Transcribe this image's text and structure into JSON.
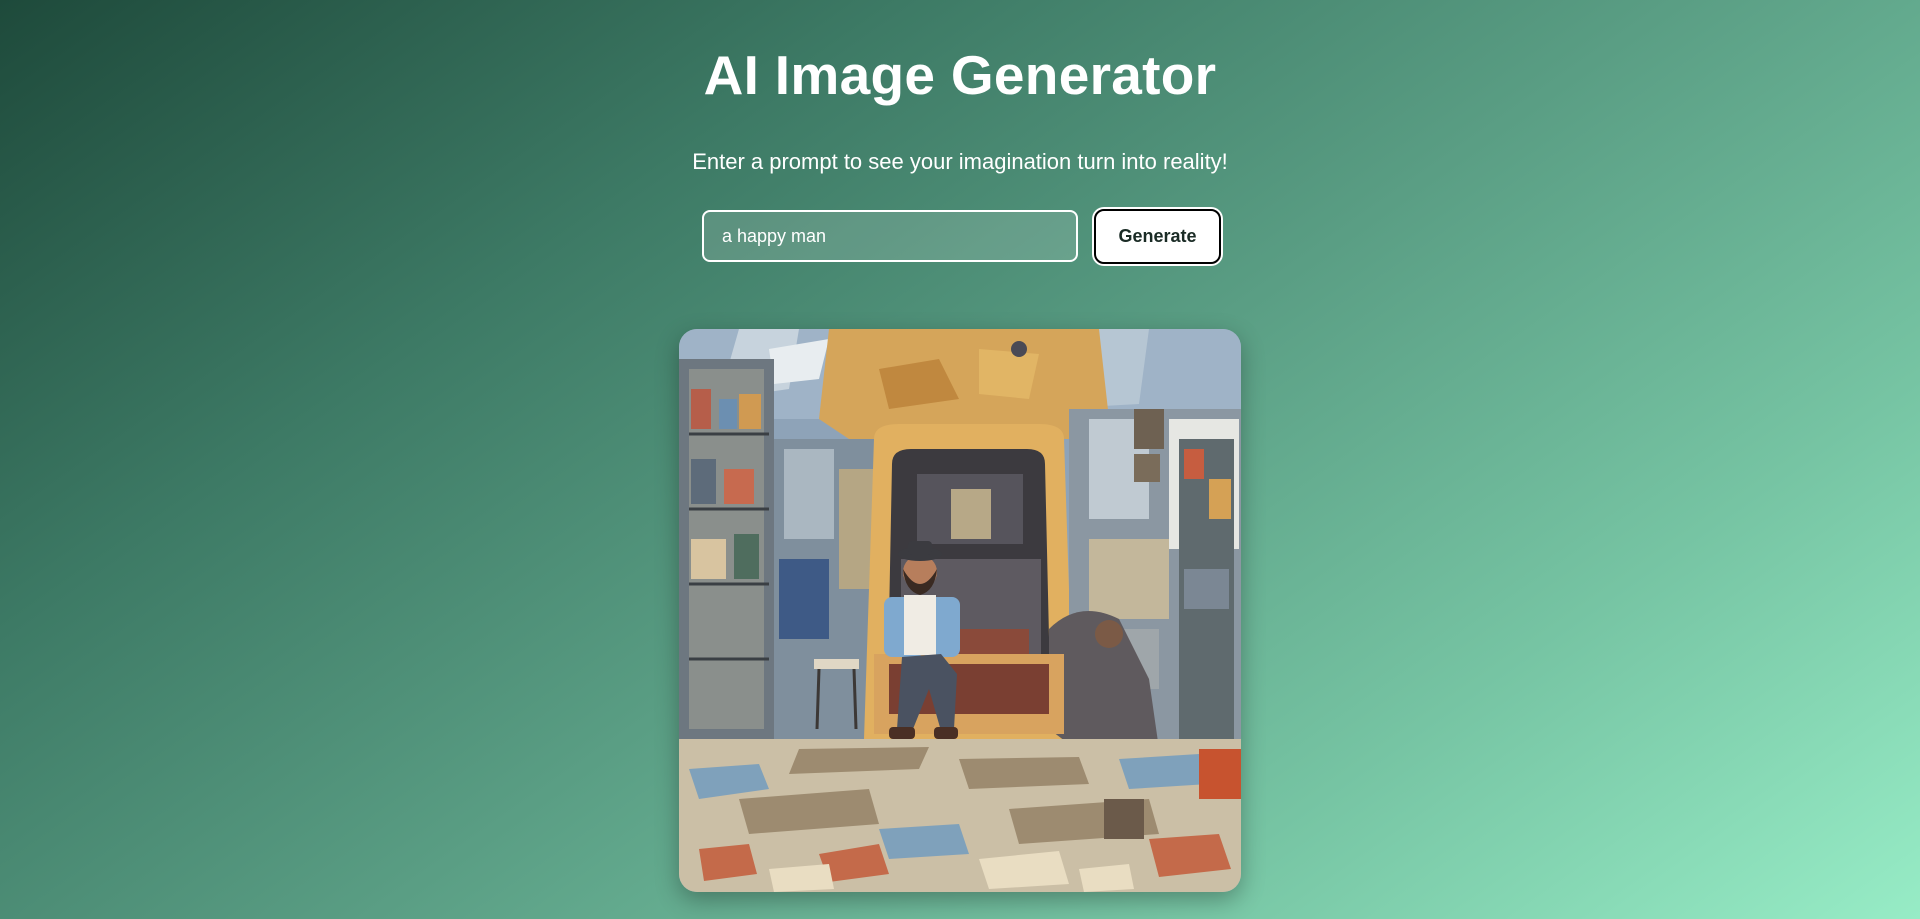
{
  "header": {
    "title": "AI Image Generator",
    "subtitle": "Enter a prompt to see your imagination turn into reality!"
  },
  "form": {
    "prompt_value": "a happy man",
    "generate_label": "Generate"
  },
  "result": {
    "image_alt": "a happy man"
  }
}
